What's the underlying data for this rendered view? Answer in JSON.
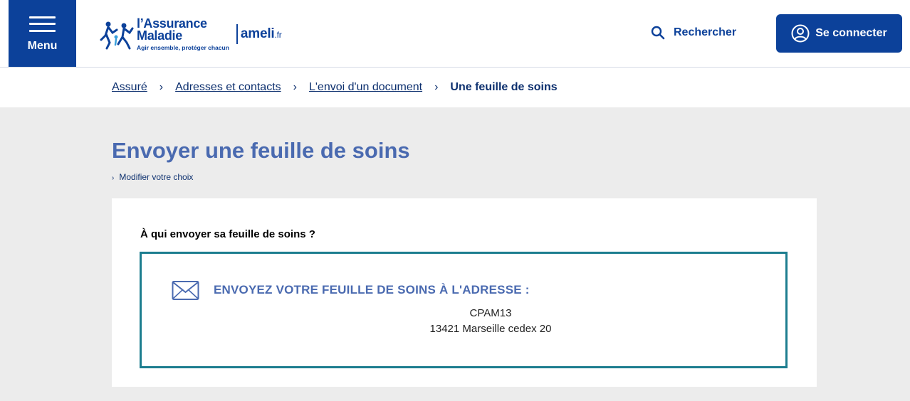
{
  "header": {
    "menu_label": "Menu",
    "logo_title_line1": "l’Assurance",
    "logo_title_line2": "Maladie",
    "logo_tagline": "Agir ensemble, protéger chacun",
    "site_name": "ameli",
    "site_suffix": ".fr",
    "search_label": "Rechercher",
    "connect_label": "Se connecter"
  },
  "breadcrumb": {
    "items": [
      "Assuré",
      "Adresses et contacts",
      "L'envoi d'un document"
    ],
    "current": "Une feuille de soins",
    "separator": "›"
  },
  "main": {
    "title": "Envoyer une feuille de soins",
    "modify_link": "Modifier votre choix",
    "question": "À qui envoyer sa feuille de soins ?",
    "address_heading": "ENVOYEZ VOTRE FEUILLE DE SOINS À L'ADRESSE :",
    "address_line1": "CPAM13",
    "address_line2": "13421 Marseille cedex 20"
  },
  "colors": {
    "primary": "#0c419a",
    "title": "#4a6ab0",
    "border_teal": "#1c7d8f",
    "background": "#ececec"
  },
  "icons": [
    "menu-icon",
    "search-icon",
    "user-icon",
    "envelope-icon",
    "chevron-right-icon"
  ]
}
